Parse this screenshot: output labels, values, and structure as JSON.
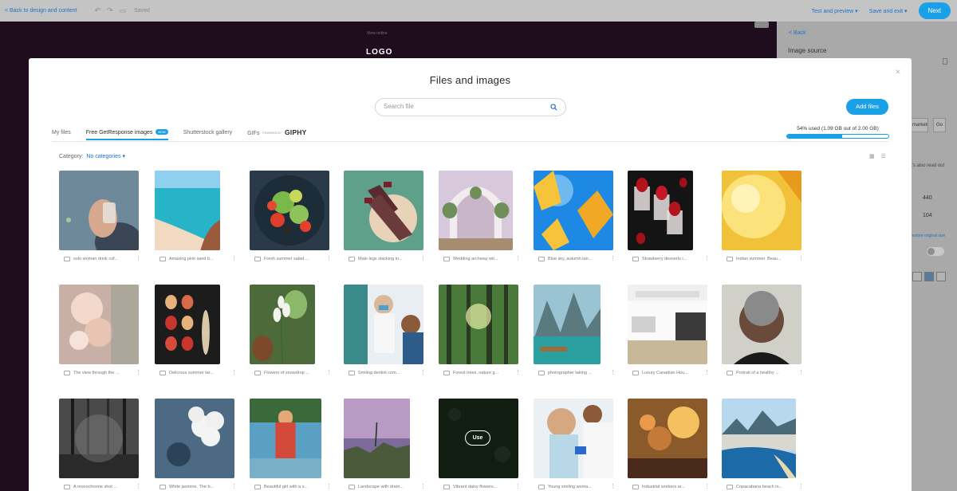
{
  "topbar": {
    "back_label": "< Back to design and content",
    "saved_label": "Saved",
    "test_preview": "Test and preview ▾",
    "save_exit": "Save and exit ▾",
    "next_label": "Next"
  },
  "canvas": {
    "view_online": "View online",
    "logo": "LOGO"
  },
  "right_panel": {
    "back": "< Back",
    "image_source": "Image source",
    "field_text": "marketin",
    "field_text_2": "Go",
    "note": "t's also read out",
    "width": "440",
    "height": "104",
    "restore": "Restore original size"
  },
  "modal": {
    "title": "Files and images",
    "close": "×",
    "search_placeholder": "Search file",
    "add_files": "Add files",
    "tabs": [
      {
        "label": "My files"
      },
      {
        "label": "Free GetResponse images",
        "badge": "NEW"
      },
      {
        "label": "Shutterstock gallery"
      },
      {
        "label": "GIFs",
        "powered": "POWERED BY",
        "brand": "GIPHY"
      }
    ],
    "usage": {
      "text": "54% used  (1.09 GB out of 2.00 GB)",
      "percent": 54
    },
    "category_label": "Category:",
    "category_value": "No categories ▾",
    "use_label": "Use",
    "images": [
      {
        "name": "solo woman drink cof..."
      },
      {
        "name": "Amazing pink sand b..."
      },
      {
        "name": "Fresh summer salad ..."
      },
      {
        "name": "Male legs stacking in..."
      },
      {
        "name": "Wedding archway wit..."
      },
      {
        "name": "Blue sky, autumn lan..."
      },
      {
        "name": "Strawberry desserts i..."
      },
      {
        "name": "Indian summer. Beau..."
      },
      {
        "name": "The view through the ..."
      },
      {
        "name": "Delicious summer tar..."
      },
      {
        "name": "Flowers of snowdrop ..."
      },
      {
        "name": "Smiling dentist com..."
      },
      {
        "name": "Forest trees. nature g..."
      },
      {
        "name": "photographer taking ..."
      },
      {
        "name": "Luxury Canadian Hou..."
      },
      {
        "name": "Portrait of a healthy ..."
      },
      {
        "name": "A monochrome shot ..."
      },
      {
        "name": "White jasmine. The b..."
      },
      {
        "name": "Beautiful girl with a s..."
      },
      {
        "name": "Landscape with dram..."
      },
      {
        "name": "Vibrant daisy flowers..."
      },
      {
        "name": "Young smiling woma..."
      },
      {
        "name": "Industrial workers ar..."
      },
      {
        "name": "Copacabana beach in..."
      }
    ]
  }
}
